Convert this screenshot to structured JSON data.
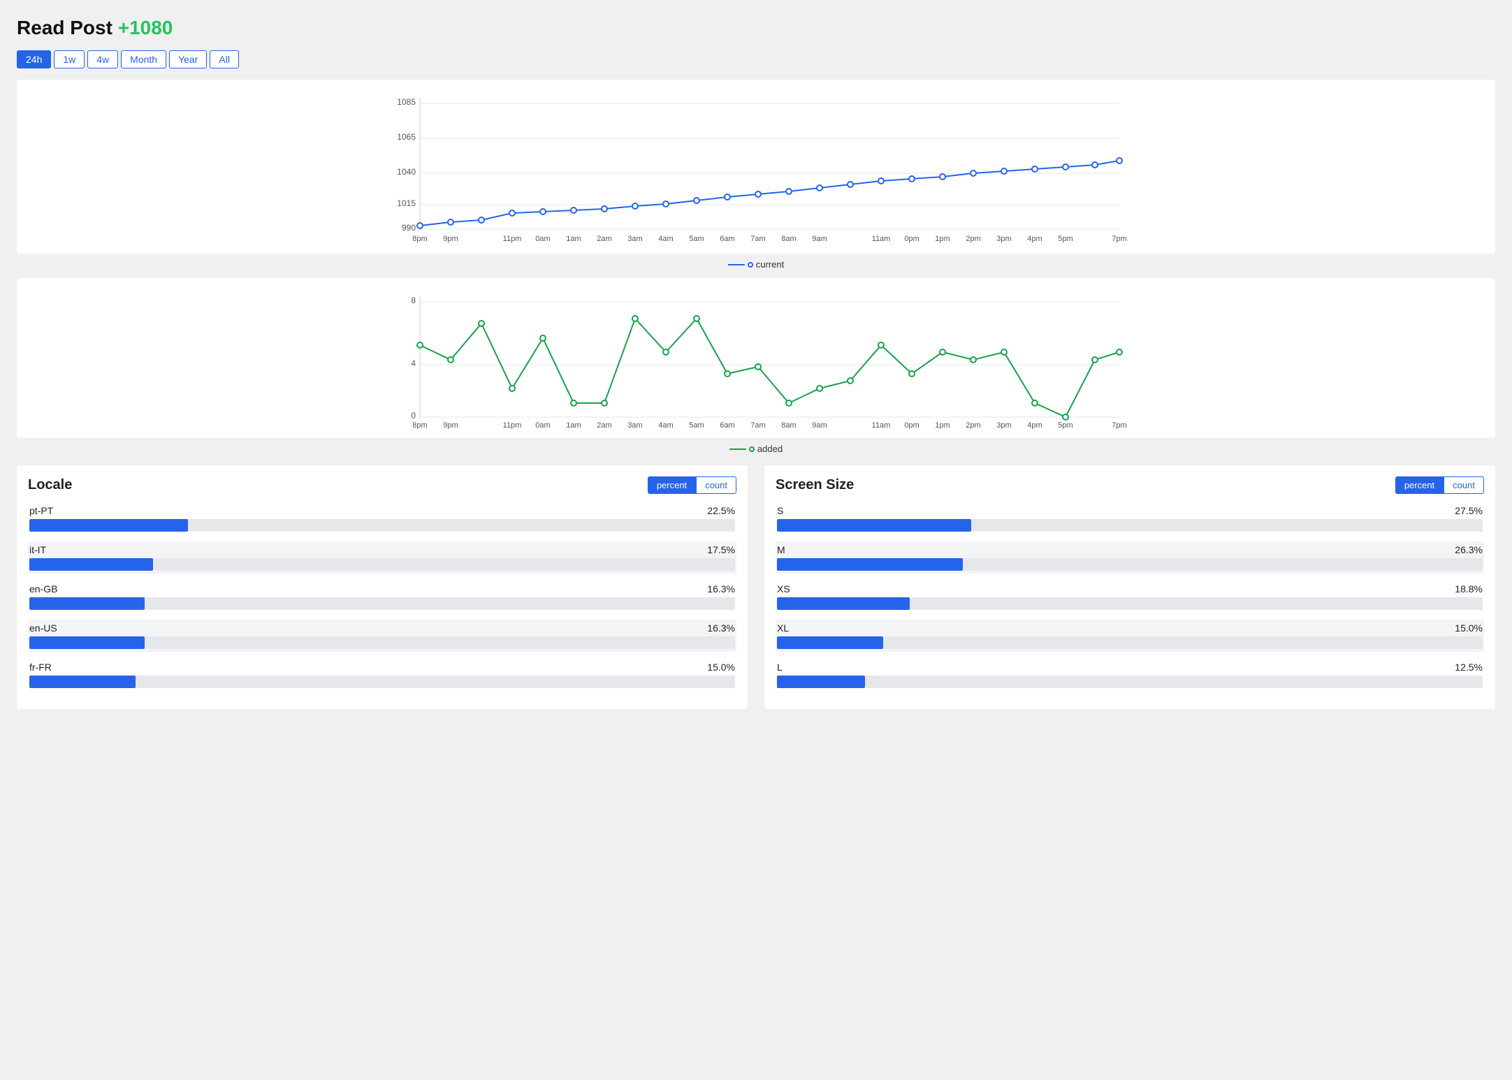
{
  "header": {
    "title": "Read Post",
    "delta": "+1080"
  },
  "timeButtons": {
    "buttons": [
      "24h",
      "1w",
      "4w",
      "Month",
      "Year",
      "All"
    ],
    "active": "24h"
  },
  "mainChart": {
    "yMin": 990,
    "yMax": 1085,
    "yTicks": [
      990,
      1015,
      1040,
      1065,
      1085
    ],
    "xLabels": [
      "8pm",
      "9pm",
      "",
      "11pm",
      "0am",
      "1am",
      "2am",
      "3am",
      "4am",
      "5am",
      "6am",
      "7am",
      "8am",
      "9am",
      "",
      "11am",
      "0pm",
      "1pm",
      "2pm",
      "3pm",
      "4pm",
      "5pm",
      "",
      "7pm"
    ],
    "legend": "current",
    "lineColor": "#2563eb"
  },
  "addedChart": {
    "yMin": 0,
    "yMax": 8,
    "yTicks": [
      0,
      4,
      8
    ],
    "xLabels": [
      "8pm",
      "9pm",
      "",
      "11pm",
      "0am",
      "1am",
      "2am",
      "3am",
      "4am",
      "5am",
      "6am",
      "7am",
      "8am",
      "9am",
      "",
      "11am",
      "0pm",
      "1pm",
      "2pm",
      "3pm",
      "4pm",
      "5pm",
      "",
      "7pm"
    ],
    "legend": "added",
    "lineColor": "#16a34a"
  },
  "locale": {
    "title": "Locale",
    "togglePercent": "percent",
    "toggleCount": "count",
    "items": [
      {
        "label": "pt-PT",
        "value": "22.5%",
        "pct": 22.5
      },
      {
        "label": "it-IT",
        "value": "17.5%",
        "pct": 17.5
      },
      {
        "label": "en-GB",
        "value": "16.3%",
        "pct": 16.3
      },
      {
        "label": "en-US",
        "value": "16.3%",
        "pct": 16.3
      },
      {
        "label": "fr-FR",
        "value": "15.0%",
        "pct": 15.0
      }
    ]
  },
  "screenSize": {
    "title": "Screen Size",
    "togglePercent": "percent",
    "toggleCount": "count",
    "items": [
      {
        "label": "S",
        "value": "27.5%",
        "pct": 27.5
      },
      {
        "label": "M",
        "value": "26.3%",
        "pct": 26.3
      },
      {
        "label": "XS",
        "value": "18.8%",
        "pct": 18.8
      },
      {
        "label": "XL",
        "value": "15.0%",
        "pct": 15.0
      },
      {
        "label": "L",
        "value": "12.5%",
        "pct": 12.5
      }
    ]
  }
}
